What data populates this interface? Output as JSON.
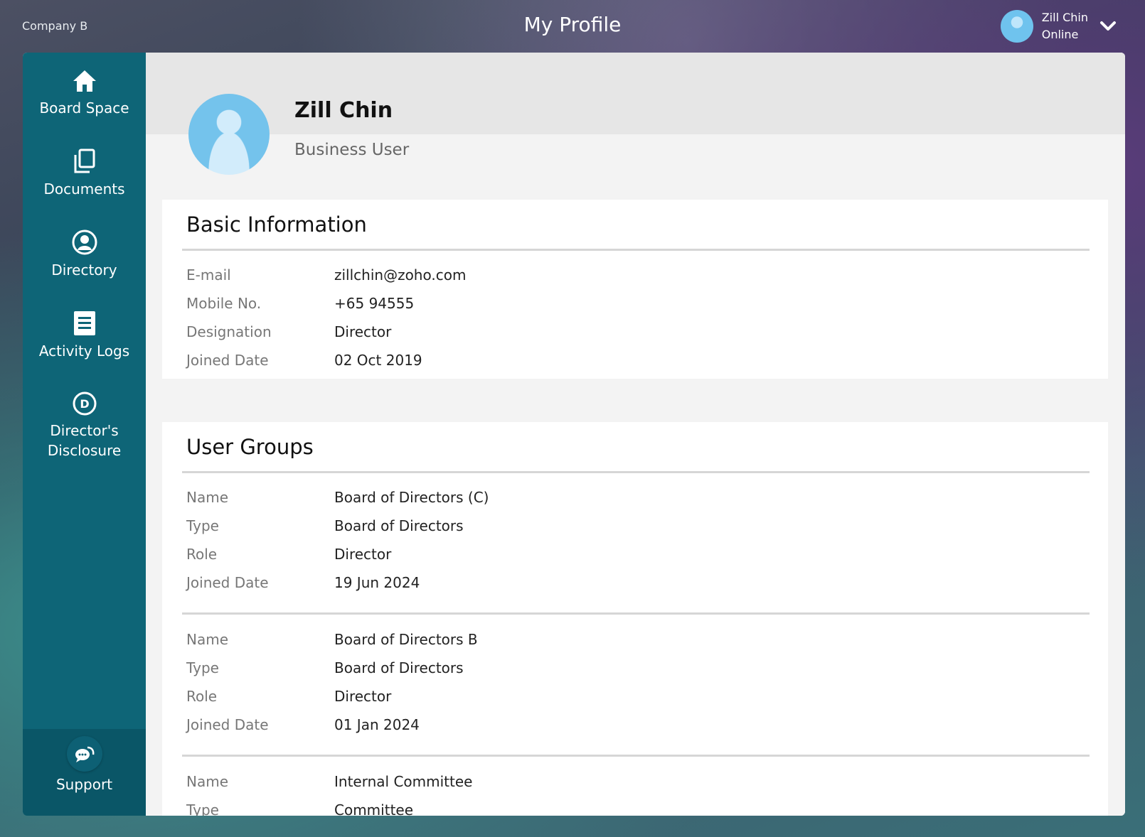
{
  "topbar": {
    "company": "Company B",
    "title": "My Profile",
    "user_name": "Zill Chin",
    "user_status": "Online"
  },
  "sidebar": {
    "items": [
      {
        "label": "Board Space",
        "icon": "home-icon"
      },
      {
        "label": "Documents",
        "icon": "documents-icon"
      },
      {
        "label": "Directory",
        "icon": "user-circle-icon"
      },
      {
        "label": "Activity Logs",
        "icon": "list-icon"
      },
      {
        "label": "Director's\nDisclosure",
        "icon": "d-circle-icon"
      }
    ],
    "support_label": "Support"
  },
  "profile": {
    "name": "Zill Chin",
    "role": "Business User"
  },
  "basic_info": {
    "title": "Basic Information",
    "rows": [
      {
        "label": "E-mail",
        "value": "zillchin@zoho.com"
      },
      {
        "label": "Mobile No.",
        "value": "+65 94555"
      },
      {
        "label": "Designation",
        "value": "Director"
      },
      {
        "label": "Joined Date",
        "value": "02 Oct 2019"
      }
    ]
  },
  "user_groups": {
    "title": "User Groups",
    "groups": [
      {
        "rows": [
          {
            "label": "Name",
            "value": "Board of Directors (C)"
          },
          {
            "label": "Type",
            "value": "Board of Directors"
          },
          {
            "label": "Role",
            "value": "Director"
          },
          {
            "label": "Joined Date",
            "value": "19 Jun 2024"
          }
        ]
      },
      {
        "rows": [
          {
            "label": "Name",
            "value": "Board of Directors B"
          },
          {
            "label": "Type",
            "value": "Board of Directors"
          },
          {
            "label": "Role",
            "value": "Director"
          },
          {
            "label": "Joined Date",
            "value": "01 Jan 2024"
          }
        ]
      },
      {
        "rows": [
          {
            "label": "Name",
            "value": "Internal Committee"
          },
          {
            "label": "Type",
            "value": "Committee"
          }
        ]
      }
    ]
  },
  "colors": {
    "sidebar": "#0e6577",
    "support_bg": "#0a5667",
    "avatar": "#74c3ec"
  }
}
